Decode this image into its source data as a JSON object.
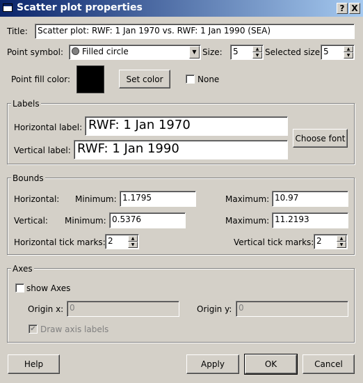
{
  "window": {
    "title": "Scatter plot properties",
    "help_glyph": "?",
    "close_glyph": "X"
  },
  "title_row": {
    "label": "Title:",
    "value": "Scatter plot: RWF: 1 Jan 1970 vs. RWF: 1 Jan 1990 (SEA)"
  },
  "point_row": {
    "symbol_label": "Point symbol:",
    "symbol_value": "Filled circle",
    "size_label": "Size:",
    "size_value": "5",
    "selected_size_label": "Selected size:",
    "selected_size_value": "5"
  },
  "fill_row": {
    "label": "Point fill color:",
    "swatch_color": "#000000",
    "set_color_label": "Set color",
    "none_label": "None",
    "none_checked": false
  },
  "labels_group": {
    "title": "Labels",
    "horizontal_label": "Horizontal label:",
    "horizontal_value": "RWF: 1 Jan 1970",
    "vertical_label": "Vertical label:",
    "vertical_value": "RWF: 1 Jan 1990",
    "choose_font_label": "Choose font"
  },
  "bounds_group": {
    "title": "Bounds",
    "horizontal_label": "Horizontal:",
    "vertical_label": "Vertical:",
    "minimum_label": "Minimum:",
    "maximum_label": "Maximum:",
    "h_min": "1.1795",
    "h_max": "10.97",
    "v_min": "0.5376",
    "v_max": "11.2193",
    "h_ticks_label": "Horizontal tick marks:",
    "h_ticks_value": "2",
    "v_ticks_label": "Vertical tick marks:",
    "v_ticks_value": "2"
  },
  "axes_group": {
    "title": "Axes",
    "show_axes_label": "show Axes",
    "show_axes_checked": false,
    "origin_x_label": "Origin x:",
    "origin_x_value": "0",
    "origin_y_label": "Origin y:",
    "origin_y_value": "0",
    "draw_axis_labels_label": "Draw axis labels",
    "draw_axis_labels_checked": true
  },
  "buttons": {
    "help": "Help",
    "apply": "Apply",
    "ok": "OK",
    "cancel": "Cancel"
  }
}
